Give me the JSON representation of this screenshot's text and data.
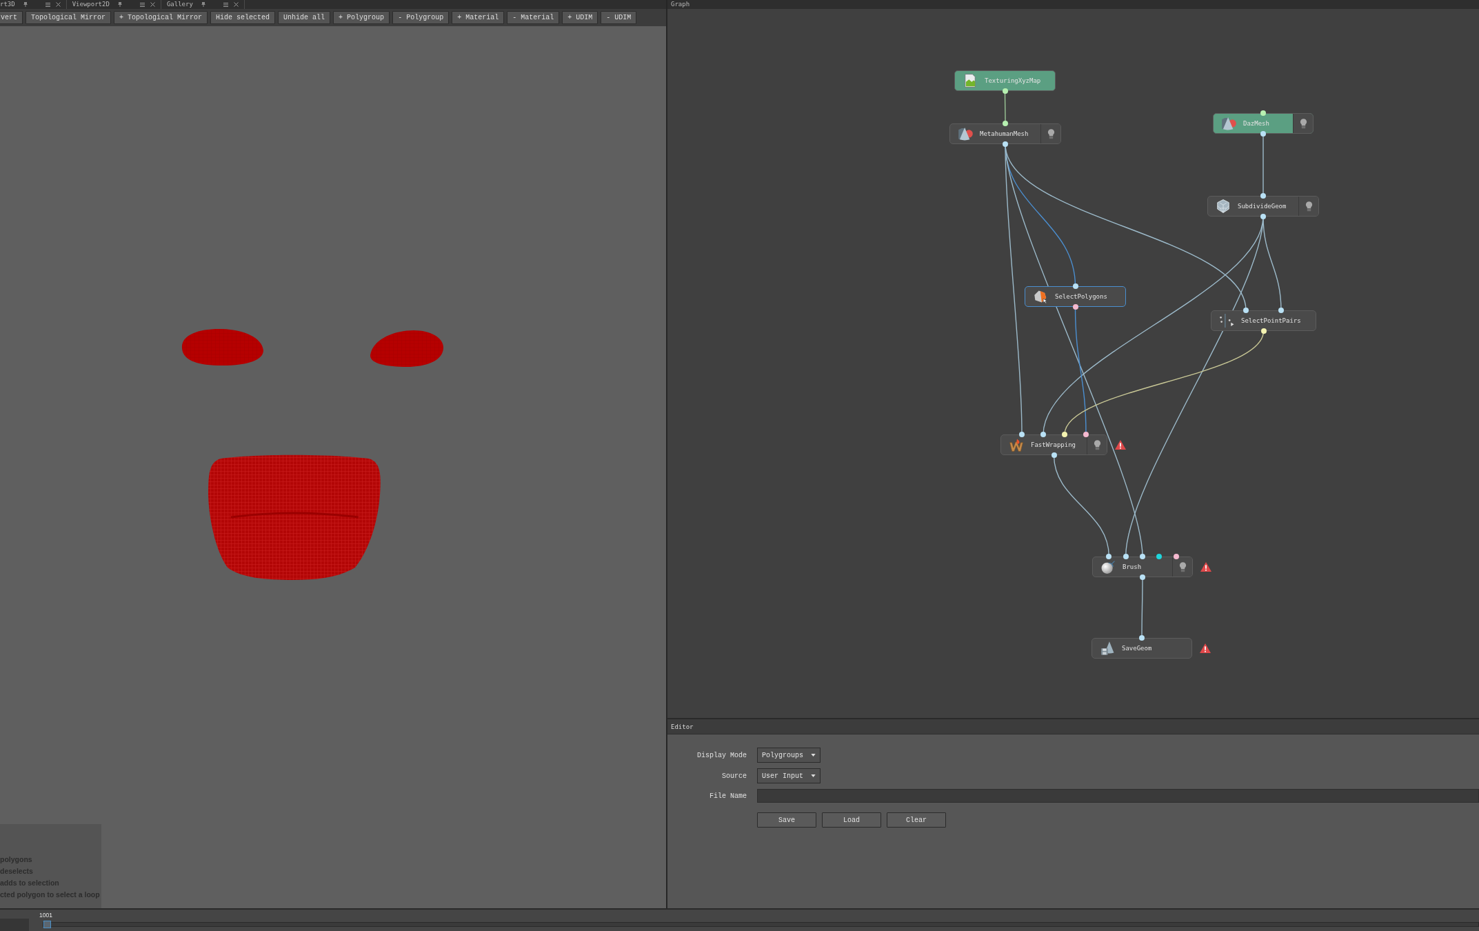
{
  "left_panel": {
    "tabs": [
      {
        "label": "rt3D"
      },
      {
        "label": "Viewport2D"
      },
      {
        "label": "Gallery"
      }
    ],
    "toolbar": [
      "vert",
      "Topological Mirror",
      "+ Topological Mirror",
      "Hide selected",
      "Unhide all",
      "+ Polygroup",
      "- Polygroup",
      "+ Material",
      "- Material",
      "+ UDIM",
      "- UDIM"
    ],
    "help_lines": [
      "polygons",
      "deselects",
      "adds to selection",
      "cted polygon to select a loop"
    ]
  },
  "graph": {
    "tab": "Graph",
    "nodes": [
      {
        "label": "TexturingXyzMap",
        "kind": "image",
        "color": "#5b9f82",
        "selected": false,
        "warning": false,
        "outputs": [
          {
            "color": "#b7f0b1"
          }
        ]
      },
      {
        "label": "MetahumanMesh",
        "kind": "mesh",
        "color": "#4a4a4a",
        "selected": false,
        "warning": false,
        "light": {
          "on": false
        },
        "inputs": [
          {
            "color": "#b7f0b1"
          }
        ],
        "outputs": [
          {
            "color": "#b9e1f5"
          }
        ]
      },
      {
        "label": "DazMesh",
        "kind": "mesh",
        "color": "#5b9f82",
        "selected": false,
        "warning": false,
        "light": {
          "on": false
        },
        "inputs": [
          {
            "color": "#b7f0b1"
          }
        ],
        "outputs": [
          {
            "color": "#b9e1f5"
          }
        ]
      },
      {
        "label": "SubdivideGeom",
        "kind": "subdivide",
        "color": "#4a4a4a",
        "selected": false,
        "warning": false,
        "light": {
          "on": false
        },
        "inputs": [
          {
            "color": "#b9e1f5"
          }
        ],
        "outputs": [
          {
            "color": "#b9e1f5"
          }
        ]
      },
      {
        "label": "SelectPolygons",
        "kind": "select-polygons",
        "color": "#4a4a4a",
        "selected": true,
        "warning": false,
        "inputs": [
          {
            "color": "#b9e1f5"
          }
        ],
        "outputs": [
          {
            "color": "#f5b9cf"
          }
        ]
      },
      {
        "label": "SelectPointPairs",
        "kind": "select-point-pairs",
        "color": "#4a4a4a",
        "selected": false,
        "warning": false,
        "inputs": [
          {
            "color": "#b9e1f5"
          },
          {
            "color": "#b9e1f5"
          }
        ],
        "outputs": [
          {
            "color": "#f4f3b1"
          }
        ]
      },
      {
        "label": "FastWrapping",
        "kind": "wrapping",
        "color": "#4a4a4a",
        "selected": false,
        "warning": true,
        "light": {
          "on": false
        },
        "inputs": [
          {
            "color": "#b9e1f5"
          },
          {
            "color": "#b9e1f5"
          },
          {
            "color": "#f4f3b1"
          },
          {
            "color": "#f5b9cf"
          }
        ],
        "outputs": [
          {
            "color": "#b9e1f5"
          }
        ]
      },
      {
        "label": "Brush",
        "kind": "brush",
        "color": "#4a4a4a",
        "selected": false,
        "warning": true,
        "light": {
          "on": false
        },
        "inputs": [
          {
            "color": "#b9e1f5"
          },
          {
            "color": "#b9e1f5"
          },
          {
            "color": "#b9e1f5"
          },
          {
            "color": "#1fd6dc"
          },
          {
            "color": "#f5b9cf"
          }
        ],
        "outputs": [
          {
            "color": "#b9e1f5"
          }
        ]
      },
      {
        "label": "SaveGeom",
        "kind": "save",
        "color": "#4a4a4a",
        "selected": false,
        "warning": true,
        "inputs": [
          {
            "color": "#b9e1f5"
          }
        ]
      }
    ]
  },
  "editor": {
    "title": "Editor",
    "fields": [
      {
        "kind": "dropdown",
        "label": "Display Mode",
        "value": "Polygroups"
      },
      {
        "kind": "dropdown",
        "label": "Source",
        "value": "User Input"
      },
      {
        "kind": "text",
        "label": "File Name"
      }
    ],
    "buttons": [
      "Save",
      "Load",
      "Clear"
    ]
  },
  "timeline": {
    "frame": "1001",
    "slider": {
      "level": 0
    }
  }
}
